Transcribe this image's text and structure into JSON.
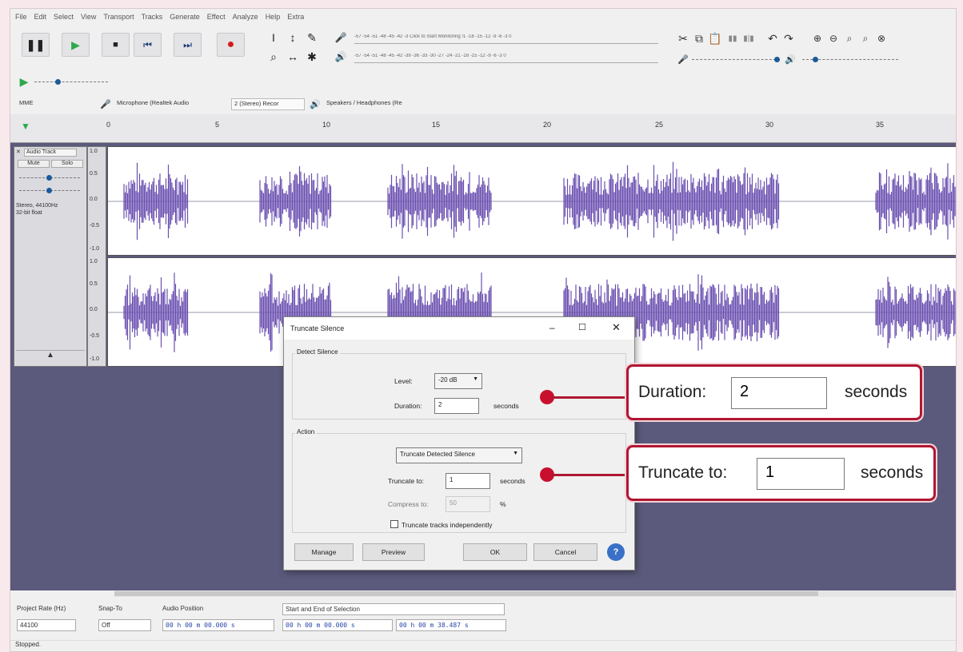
{
  "menu": [
    "File",
    "Edit",
    "Select",
    "View",
    "Transport",
    "Tracks",
    "Generate",
    "Effect",
    "Analyze",
    "Help",
    "Extra"
  ],
  "meters": {
    "record_scale": "-57 -54 -51 -48 -45 -42 -3 Click to Start Monitoring !1 -18 -15 -12 -9 -6 -3 0",
    "playback_scale": "-57 -54 -51 -48 -45 -42 -39 -36 -33 -30 -27 -24 -21 -18 -15 -12 -9 -6 -3 0"
  },
  "device": {
    "host": "MME",
    "mic": "Microphone (Realtek Audio",
    "channels": "2 (Stereo) Recor",
    "speakers": "Speakers / Headphones (Re"
  },
  "ruler_ticks": [
    "0",
    "5",
    "10",
    "15",
    "20",
    "25",
    "30",
    "35"
  ],
  "track": {
    "name": "Audio Track",
    "mute": "Mute",
    "solo": "Solo",
    "info_line1": "Stereo, 44100Hz",
    "info_line2": "32-bit float",
    "scale": [
      "1.0",
      "0.5",
      "0.0",
      "-0.5",
      "-1.0"
    ],
    "wave_color": "#6a4fb0"
  },
  "dialog": {
    "title": "Truncate Silence",
    "detect_group": "Detect Silence",
    "level_label": "Level:",
    "level_value": "-20 dB",
    "duration_label": "Duration:",
    "duration_value": "2",
    "seconds": "seconds",
    "action_group": "Action",
    "action_value": "Truncate Detected Silence",
    "truncate_label": "Truncate to:",
    "truncate_value": "1",
    "compress_label": "Compress to:",
    "compress_value": "50",
    "percent": "%",
    "independent_label": "Truncate tracks independently",
    "manage": "Manage",
    "preview": "Preview",
    "ok": "OK",
    "cancel": "Cancel",
    "help": "?"
  },
  "callouts": {
    "duration_label": "Duration:",
    "duration_value": "2",
    "truncate_label": "Truncate to:",
    "truncate_value": "1",
    "unit": "seconds",
    "accent": "#b01631"
  },
  "bottom": {
    "rate_label": "Project Rate (Hz)",
    "rate_value": "44100",
    "snap_label": "Snap-To",
    "snap_value": "Off",
    "position_label": "Audio Position",
    "position_value": "00 h 00 m 00.000 s",
    "selection_label": "Start and End of Selection",
    "selection_start": "00 h 00 m 00.000 s",
    "selection_end": "00 h 00 m 38.487 s"
  },
  "status": "Stopped."
}
